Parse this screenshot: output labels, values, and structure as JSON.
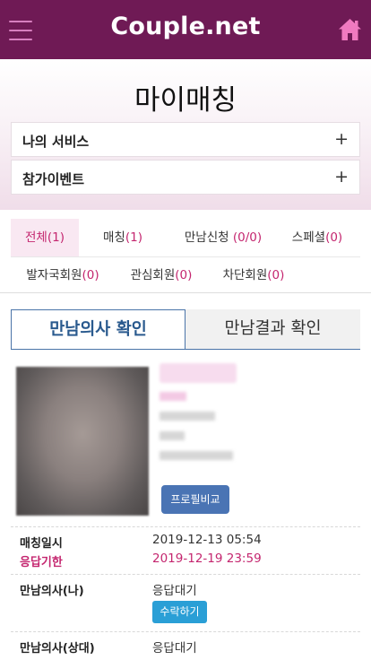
{
  "header": {
    "brand": "Couple.net",
    "menu_icon": "hamburger-menu-icon",
    "home_icon": "home-icon"
  },
  "hero": {
    "title": "마이매칭",
    "accordions": [
      {
        "label": "나의 서비스",
        "toggle": "+"
      },
      {
        "label": "참가이벤트",
        "toggle": "+"
      }
    ]
  },
  "filters": {
    "row1": [
      {
        "label": "전체",
        "count": "(1)",
        "active": true
      },
      {
        "label": "매칭",
        "count": "(1)"
      },
      {
        "label": "만남신청 ",
        "count": "(0/0)"
      },
      {
        "label": "스페셜",
        "count": "(0)"
      }
    ],
    "row2": [
      {
        "label": "발자국회원",
        "count": "(0)"
      },
      {
        "label": "관심회원",
        "count": "(0)"
      },
      {
        "label": "차단회원",
        "count": "(0)"
      }
    ]
  },
  "segments": {
    "active": "만남의사 확인",
    "inactive": "만남결과 확인"
  },
  "profile": {
    "compare_button": "프로필비교"
  },
  "details": {
    "match_date_label": "매칭일시",
    "match_date": "2019-12-13 05:54",
    "deadline_label": "응답기한",
    "deadline": "2019-12-19 23:59",
    "my_intent_label": "만남의사(나)",
    "my_intent": "응답대기",
    "accept_button": "수락하기",
    "partner_intent_label": "만남의사(상대)",
    "partner_intent": "응답대기"
  },
  "colors": {
    "header_bg": "#6f1a55",
    "accent": "#c4266f",
    "segment_blue": "#4a74a8",
    "accept_blue": "#2a9fd6"
  }
}
